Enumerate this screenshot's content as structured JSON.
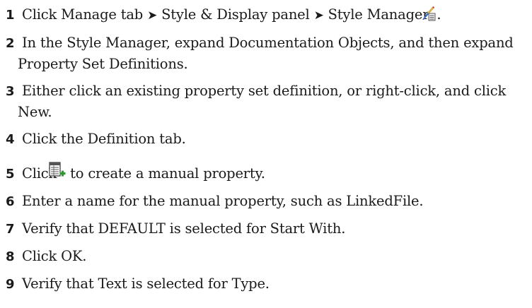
{
  "steps": [
    {
      "number": "1",
      "parts": {
        "a": "Click Manage tab",
        "b": "Style & Display panel",
        "c": "Style Manager",
        "d": "."
      },
      "separator": "➤",
      "icon": "style-manager-icon"
    },
    {
      "number": "2",
      "text": "In the Style Manager, expand Documentation Objects, and then expand Property Set Definitions."
    },
    {
      "number": "3",
      "text": "Either click an existing property set definition, or right-click, and click New."
    },
    {
      "number": "4",
      "text": "Click the Definition tab."
    },
    {
      "number": "5",
      "before": "Click",
      "after": "to create a manual property.",
      "icon": "add-manual-property-icon"
    },
    {
      "number": "6",
      "text": "Enter a name for the manual property, such as LinkedFile."
    },
    {
      "number": "7",
      "text": "Verify that DEFAULT is selected for Start With."
    },
    {
      "number": "8",
      "text": "Click OK."
    },
    {
      "number": "9",
      "text": "Verify that Text is selected for Type."
    }
  ],
  "colors": {
    "text": "#1a1a1a",
    "icon_green": "#2e9a2e"
  }
}
